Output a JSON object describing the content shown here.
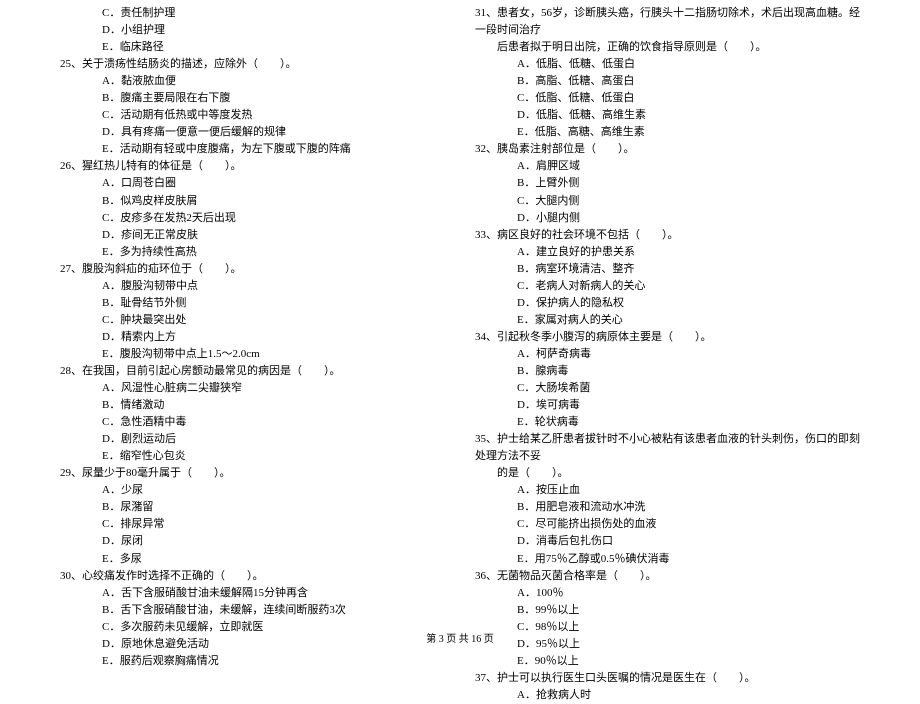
{
  "left": {
    "pre_opts": [
      "C．责任制护理",
      "D．小组护理",
      "E．临床路径"
    ],
    "q25": {
      "stem": "25、关于溃疡性结肠炎的描述，应除外（　　）。",
      "opts": [
        "A．黏液脓血便",
        "B．腹痛主要局限在右下腹",
        "C．活动期有低热或中等度发热",
        "D．具有疼痛一便意一便后缓解的规律",
        "E．活动期有轻或中度腹痛，为左下腹或下腹的阵痛"
      ]
    },
    "q26": {
      "stem": "26、猩红热儿特有的体征是（　　）。",
      "opts": [
        "A．口周苍白圈",
        "B．似鸡皮样皮肤屑",
        "C．皮疹多在发热2天后出现",
        "D．疹间无正常皮肤",
        "E．多为持续性高热"
      ]
    },
    "q27": {
      "stem": "27、腹股沟斜疝的疝环位于（　　）。",
      "opts": [
        "A．腹股沟韧带中点",
        "B．耻骨结节外侧",
        "C．肿块最突出处",
        "D．精索内上方",
        "E．腹股沟韧带中点上1.5～2.0cm"
      ]
    },
    "q28": {
      "stem": "28、在我国，目前引起心房颤动最常见的病因是（　　）。",
      "opts": [
        "A．风湿性心脏病二尖瓣狭窄",
        "B．情绪激动",
        "C．急性酒精中毒",
        "D．剧烈运动后",
        "E．缩窄性心包炎"
      ]
    },
    "q29": {
      "stem": "29、尿量少于80毫升属于（　　）。",
      "opts": [
        "A．少尿",
        "B．尿潴留",
        "C．排尿异常",
        "D．尿闭",
        "E．多尿"
      ]
    },
    "q30": {
      "stem": "30、心绞痛发作时选择不正确的（　　）。",
      "opts": [
        "A．舌下含服硝酸甘油未缓解隔15分钟再含",
        "B．舌下含服硝酸甘油，未缓解，连续间断服药3次",
        "C．多次服药未见缓解，立即就医",
        "D．原地休息避免活动",
        "E．服药后观察胸痛情况"
      ]
    }
  },
  "right": {
    "q31": {
      "stem": "31、患者女，56岁，诊断胰头癌，行胰头十二指肠切除术，术后出现高血糖。经一段时间治疗",
      "cont": "后患者拟于明日出院，正确的饮食指导原则是（　　）。",
      "opts": [
        "A．低脂、低糖、低蛋白",
        "B．高脂、低糖、高蛋白",
        "C．低脂、低糖、低蛋白",
        "D．低脂、低糖、高维生素",
        "E．低脂、高糖、高维生素"
      ]
    },
    "q32": {
      "stem": "32、胰岛素注射部位是（　　）。",
      "opts": [
        "A．肩胛区域",
        "B．上臂外侧",
        "C．大腿内侧",
        "D．小腿内侧"
      ]
    },
    "q33": {
      "stem": "33、病区良好的社会环境不包括（　　）。",
      "opts": [
        "A．建立良好的护患关系",
        "B．病室环境清洁、整齐",
        "C．老病人对新病人的关心",
        "D．保护病人的隐私权",
        "E．家属对病人的关心"
      ]
    },
    "q34": {
      "stem": "34、引起秋冬季小腹泻的病原体主要是（　　）。",
      "opts": [
        "A．柯萨奇病毒",
        "B．腺病毒",
        "C．大肠埃希菌",
        "D．埃可病毒",
        "E．轮状病毒"
      ]
    },
    "q35": {
      "stem": "35、护士给某乙肝患者拔针时不小心被粘有该患者血液的针头刺伤，伤口的即刻处理方法不妥",
      "cont": "的是（　　）。",
      "opts": [
        "A．按压止血",
        "B．用肥皂液和流动水冲洗",
        "C．尽可能挤出损伤处的血液",
        "D．消毒后包扎伤口",
        "E．用75％乙醇或0.5％碘伏消毒"
      ]
    },
    "q36": {
      "stem": "36、无菌物品灭菌合格率是（　　）。",
      "opts": [
        "A．100％",
        "B．99％以上",
        "C．98％以上",
        "D．95％以上",
        "E．90％以上"
      ]
    },
    "q37": {
      "stem": "37、护士可以执行医生口头医嘱的情况是医生在（　　）。",
      "opts": [
        "A．抢救病人时"
      ]
    }
  },
  "footer": "第 3 页 共 16 页"
}
